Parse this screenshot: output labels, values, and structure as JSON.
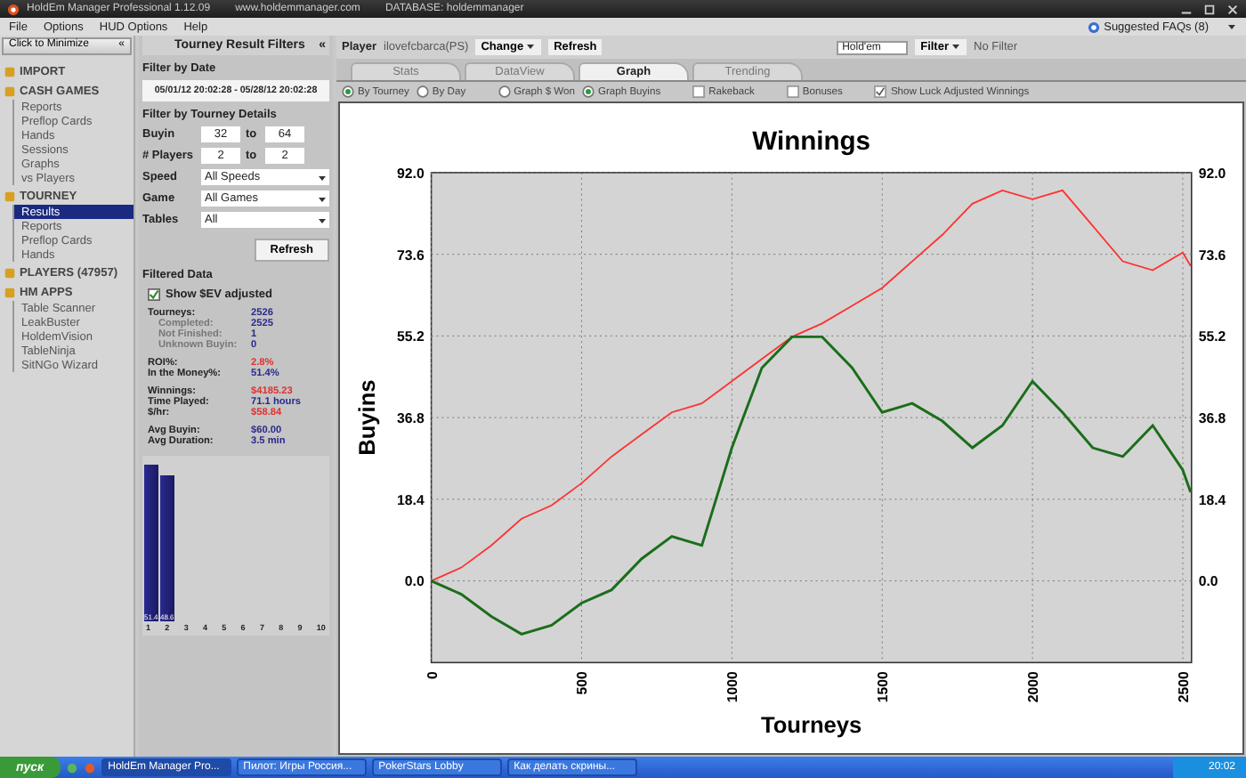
{
  "window": {
    "title": "HoldEm Manager Professional 1.12.09",
    "website": "www.holdemmanager.com",
    "database": "DATABASE: holdemmanager"
  },
  "menu": [
    "File",
    "Options",
    "HUD Options",
    "Help"
  ],
  "faq": "Suggested FAQs (8)",
  "sidebar": {
    "minimize": "Click to Minimize",
    "minimize_mark": "«",
    "items": [
      {
        "label": "IMPORT",
        "selected": false
      },
      {
        "label": "CASH GAMES",
        "selected": false,
        "children": [
          {
            "label": "Reports",
            "selected": false
          },
          {
            "label": "Preflop Cards",
            "selected": false
          },
          {
            "label": "Hands",
            "selected": false
          },
          {
            "label": "Sessions",
            "selected": false
          },
          {
            "label": "Graphs",
            "selected": false
          },
          {
            "label": "vs Players",
            "selected": false
          }
        ]
      },
      {
        "label": "TOURNEY",
        "selected": false,
        "children": [
          {
            "label": "Results",
            "selected": true
          },
          {
            "label": "Reports",
            "selected": false
          },
          {
            "label": "Preflop Cards",
            "selected": false
          },
          {
            "label": "Hands",
            "selected": false
          }
        ]
      },
      {
        "label": "PLAYERS (47957)",
        "selected": false
      },
      {
        "label": "HM APPS",
        "selected": false,
        "children": [
          {
            "label": "Table Scanner",
            "selected": false
          },
          {
            "label": "LeakBuster",
            "selected": false
          },
          {
            "label": "HoldemVision",
            "selected": false
          },
          {
            "label": "TableNinja",
            "selected": false
          },
          {
            "label": "SitNGo Wizard",
            "selected": false
          }
        ]
      }
    ]
  },
  "filters": {
    "title": "Tourney Result Filters",
    "collapse": "«",
    "date_heading": "Filter by Date",
    "date_range": "05/01/12 20:02:28 - 05/28/12 20:02:28",
    "details_heading": "Filter by Tourney Details",
    "ranges": [
      {
        "label": "Buyin",
        "from": "32",
        "to_label": "to",
        "to": "64"
      },
      {
        "label": "# Players",
        "from": "2",
        "to_label": "to",
        "to": "2"
      }
    ],
    "selects": [
      {
        "label": "Speed",
        "value": "All Speeds"
      },
      {
        "label": "Game",
        "value": "All Games"
      },
      {
        "label": "Tables",
        "value": "All"
      }
    ],
    "refresh": "Refresh",
    "data_heading": "Filtered Data",
    "ev_checkbox": {
      "label": "Show $EV adjusted",
      "checked": true
    },
    "stat_groups": [
      [
        {
          "label": "Tourneys:",
          "value": "2526",
          "kind": "main",
          "color": "#2a2a8c"
        },
        {
          "label": "Completed:",
          "value": "2525",
          "kind": "sub",
          "color": "#2a2a8c"
        },
        {
          "label": "Not Finished:",
          "value": "1",
          "kind": "sub",
          "color": "#2a2a8c"
        },
        {
          "label": "Unknown Buyin:",
          "value": "0",
          "kind": "sub",
          "color": "#2a2a8c"
        }
      ],
      [
        {
          "label": "ROI%:",
          "value": "2.8%",
          "kind": "main",
          "color": "#e03030"
        },
        {
          "label": "In the Money%:",
          "value": "51.4%",
          "kind": "main",
          "color": "#2a2a8c"
        }
      ],
      [
        {
          "label": "Winnings:",
          "value": "$4185.23",
          "kind": "main",
          "color": "#e03030"
        },
        {
          "label": "Time Played:",
          "value": "71.1 hours",
          "kind": "main",
          "color": "#2a2a8c"
        },
        {
          "label": "$/hr:",
          "value": "$58.84",
          "kind": "main",
          "color": "#e03030"
        }
      ],
      [
        {
          "label": "Avg Buyin:",
          "value": "$60.00",
          "kind": "main",
          "color": "#2a2a8c"
        },
        {
          "label": "Avg Duration:",
          "value": "3.5 min",
          "kind": "main",
          "color": "#2a2a8c"
        }
      ]
    ],
    "mini_chart": {
      "bar_labels": [
        "51.4",
        "48.6"
      ],
      "x_labels": [
        "1",
        "2",
        "3",
        "4",
        "5",
        "6",
        "7",
        "8",
        "9",
        "10"
      ]
    }
  },
  "player_bar": {
    "label": "Player",
    "name": "ilovefcbarca(PS)",
    "change": "Change",
    "refresh": "Refresh",
    "game": "Hold'em",
    "filter": "Filter",
    "filter_status": "No Filter"
  },
  "tabs": [
    {
      "label": "Stats",
      "selected": false
    },
    {
      "label": "DataView",
      "selected": false
    },
    {
      "label": "Graph",
      "selected": true
    },
    {
      "label": "Trending",
      "selected": false
    }
  ],
  "options": [
    {
      "kind": "radio",
      "label": "By Tourney",
      "selected": true
    },
    {
      "kind": "radio",
      "label": "By Day",
      "selected": false
    },
    {
      "kind": "radio",
      "label": "Graph $ Won",
      "selected": false
    },
    {
      "kind": "radio",
      "label": "Graph Buyins",
      "selected": true
    },
    {
      "kind": "checkbox",
      "label": "Rakeback",
      "checked": false
    },
    {
      "kind": "checkbox",
      "label": "Bonuses",
      "checked": false
    },
    {
      "kind": "checkbox",
      "label": "Show Luck Adjusted Winnings",
      "checked": true
    }
  ],
  "graph": {
    "chart_data": {
      "type": "line",
      "title": "Winnings",
      "xlabel": "Tourneys",
      "ylabel": "Buyins",
      "x": [
        0,
        100,
        200,
        300,
        400,
        500,
        600,
        700,
        800,
        900,
        1000,
        1100,
        1200,
        1300,
        1400,
        1500,
        1600,
        1700,
        1800,
        1900,
        2000,
        2100,
        2200,
        2300,
        2400,
        2500,
        2526
      ],
      "series": [
        {
          "color": "#ff3030",
          "values": [
            0,
            3,
            8,
            14,
            17,
            22,
            28,
            33,
            38,
            40,
            45,
            50,
            55,
            58,
            62,
            66,
            72,
            78,
            85,
            88,
            86,
            88,
            80,
            72,
            70,
            74,
            71
          ]
        },
        {
          "color": "#1a6e1a",
          "values": [
            0,
            -3,
            -8,
            -12,
            -10,
            -5,
            -2,
            5,
            10,
            8,
            30,
            48,
            55,
            55,
            48,
            38,
            40,
            36,
            30,
            35,
            45,
            38,
            30,
            28,
            35,
            25,
            20
          ]
        }
      ],
      "grid": true,
      "xlim": [
        0,
        2529
      ],
      "ylim": [
        -18.4,
        92
      ],
      "xticks": [
        0,
        500,
        1000,
        1500,
        2000,
        2500
      ],
      "yticks": [
        {
          "value": 0,
          "label": "0.0"
        },
        {
          "value": 18.4,
          "label": "18.4"
        },
        {
          "value": 36.8,
          "label": "36.8"
        },
        {
          "value": 55.2,
          "label": "55.2"
        },
        {
          "value": 73.6,
          "label": "73.6"
        },
        {
          "value": 92,
          "label": "92.0"
        }
      ]
    }
  },
  "taskbar": {
    "start": "пуск",
    "tasks": [
      {
        "label": "HoldEm Manager Pro...",
        "selected": true
      },
      {
        "label": "Пилот: Игры Россия...",
        "selected": false
      },
      {
        "label": "PokerStars Lobby",
        "selected": false
      },
      {
        "label": "Как делать скрины...",
        "selected": false
      }
    ],
    "clock": "20:02"
  }
}
